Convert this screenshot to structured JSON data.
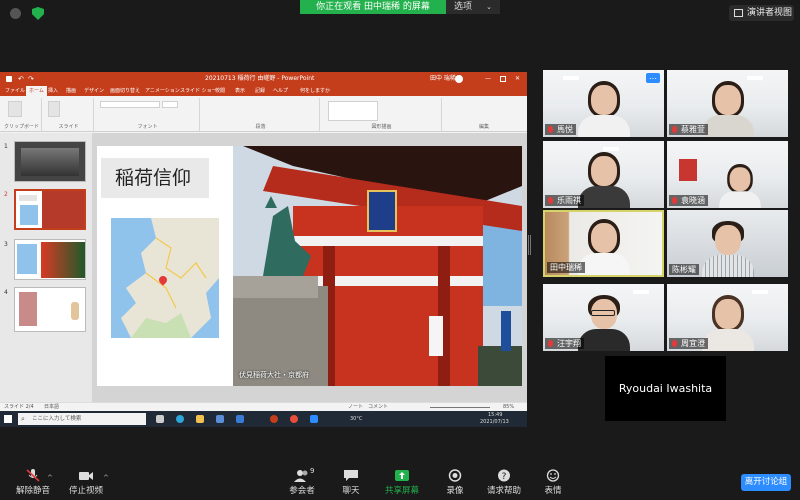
{
  "topbar": {
    "viewing_banner": "你正在观看 田中瑞稀 的屏幕",
    "options_label": "选项",
    "speaker_view_label": "演讲者视图"
  },
  "shared_screen": {
    "window_title": "20210713 稲荷行 由嵯野 - PowerPoint",
    "user_name": "田中 瑞稀",
    "tabs": [
      "ファイル",
      "ホーム",
      "挿入",
      "描画",
      "デザイン",
      "画面切り替え",
      "アニメーション",
      "スライド ショー",
      "校閲",
      "表示",
      "記録",
      "ヘルプ",
      "何をしますか"
    ],
    "ribbon_groups": [
      "クリップボード",
      "スライド",
      "フォント",
      "段落",
      "図形描画",
      "編集"
    ],
    "slide": {
      "title": "稲荷信仰",
      "photo_caption": "伏見稲荷大社・京都府"
    },
    "thumb_numbers": [
      "1",
      "2",
      "3",
      "4"
    ],
    "status_left": "スライド 2/4",
    "status_lang": "日本語",
    "status_notes": "ノート",
    "status_comments": "コメント",
    "zoom": "85%",
    "taskbar": {
      "search_placeholder": "ここに入力して検索",
      "weather": "30°C",
      "time": "15:49",
      "date": "2021/07/13"
    }
  },
  "participants": [
    {
      "name": "馬悦",
      "muted": true,
      "has_more": true
    },
    {
      "name": "蔡雅萱",
      "muted": true
    },
    {
      "name": "乐雨祺",
      "muted": true
    },
    {
      "name": "袁晓涵",
      "muted": true
    },
    {
      "name": "田中瑞稀",
      "muted": false,
      "active": true
    },
    {
      "name": "陈彬耀",
      "muted": false
    },
    {
      "name": "汪宇翔",
      "muted": true
    },
    {
      "name": "周宜澄",
      "muted": true
    }
  ],
  "name_only_tile": "Ryoudai Iwashita",
  "toolbar": {
    "unmute": "解除静音",
    "stop_video": "停止视频",
    "participants": "参会者",
    "participants_count": "9",
    "chat": "聊天",
    "share_screen": "共享屏幕",
    "record": "录像",
    "request_help": "请求帮助",
    "reactions": "表情",
    "leave_room": "离开讨论组"
  },
  "colors": {
    "zoom_green": "#23b14d",
    "zoom_blue": "#2d8cff",
    "ppt_red": "#c43e1c",
    "active_speaker": "#d7d36b"
  }
}
